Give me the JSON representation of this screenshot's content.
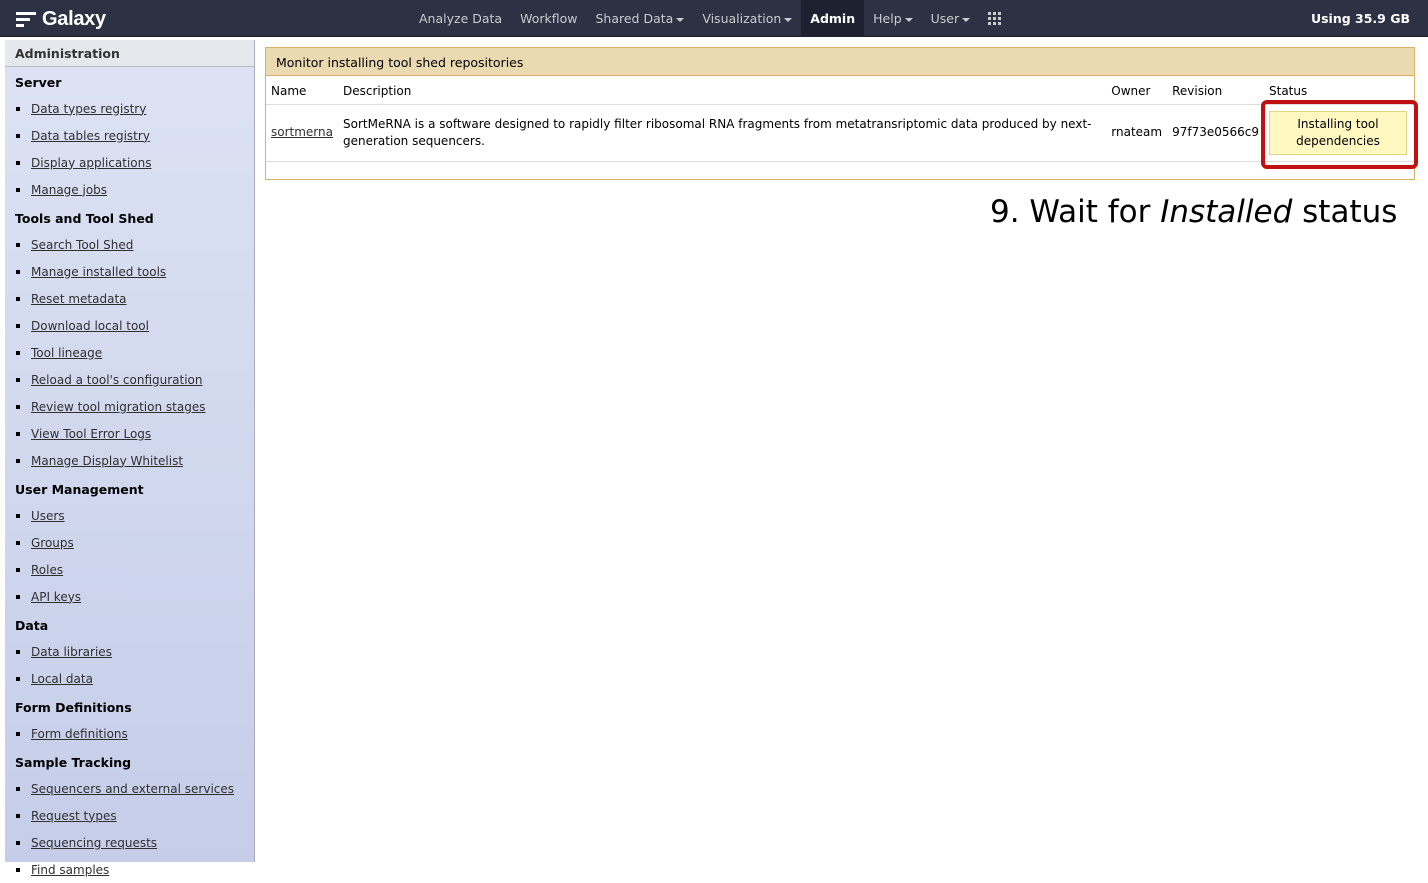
{
  "brand": {
    "title": "Galaxy"
  },
  "nav": {
    "items": [
      {
        "label": "Analyze Data"
      },
      {
        "label": "Workflow"
      },
      {
        "label": "Shared Data"
      },
      {
        "label": "Visualization"
      },
      {
        "label": "Admin"
      },
      {
        "label": "Help"
      },
      {
        "label": "User"
      }
    ],
    "quota": "Using 35.9 GB"
  },
  "left_panel": {
    "header": "Administration",
    "sections": [
      {
        "title": "Server",
        "items": [
          "Data types registry",
          "Data tables registry",
          "Display applications",
          "Manage jobs"
        ]
      },
      {
        "title": "Tools and Tool Shed",
        "items": [
          "Search Tool Shed",
          "Manage installed tools",
          "Reset metadata",
          "Download local tool",
          "Tool lineage",
          "Reload a tool's configuration",
          "Review tool migration stages",
          "View Tool Error Logs",
          "Manage Display Whitelist"
        ]
      },
      {
        "title": "User Management",
        "items": [
          "Users",
          "Groups",
          "Roles",
          "API keys"
        ]
      },
      {
        "title": "Data",
        "items": [
          "Data libraries",
          "Local data"
        ]
      },
      {
        "title": "Form Definitions",
        "items": [
          "Form definitions"
        ]
      },
      {
        "title": "Sample Tracking",
        "items": [
          "Sequencers and external services",
          "Request types",
          "Sequencing requests",
          "Find samples"
        ]
      }
    ]
  },
  "main": {
    "form_title": "Monitor installing tool shed repositories",
    "columns": {
      "name": "Name",
      "description": "Description",
      "owner": "Owner",
      "revision": "Revision",
      "status": "Status"
    },
    "rows": [
      {
        "name": "sortmerna",
        "description": "SortMeRNA is a software designed to rapidly filter ribosomal RNA fragments from metatransriptomic data produced by next-generation sequencers.",
        "owner": "rnateam",
        "revision": "97f73e0566c9",
        "status": "Installing tool dependencies"
      }
    ]
  },
  "annotation": {
    "prefix": "9. Wait for ",
    "emphasis": "Installed",
    "suffix": " status"
  },
  "colors": {
    "highlight": "#c01010",
    "status_bg": "#fff8c0",
    "form_title_bg": "#ebd9b2",
    "masthead": "#2c3143"
  }
}
